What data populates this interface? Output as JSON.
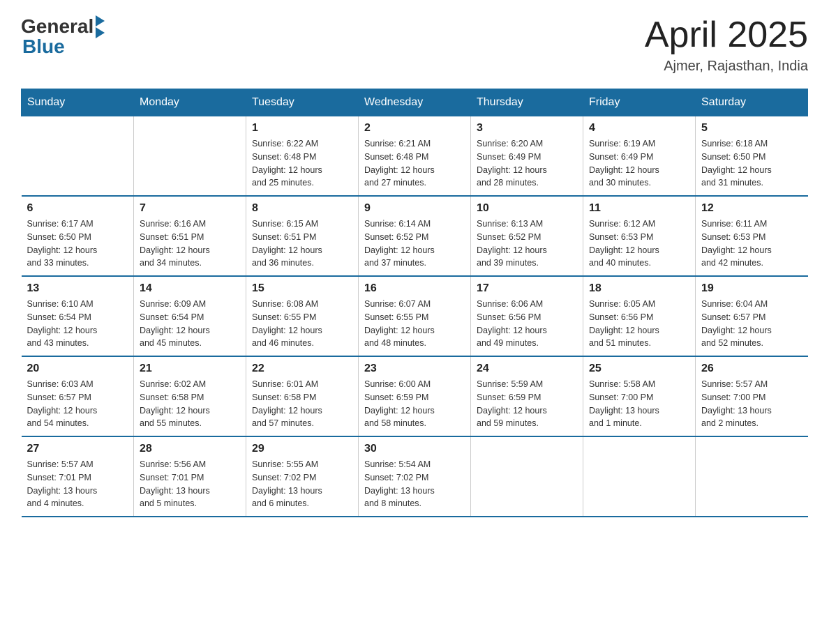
{
  "header": {
    "logo_general": "General",
    "logo_blue": "Blue",
    "title": "April 2025",
    "location": "Ajmer, Rajasthan, India"
  },
  "days_of_week": [
    "Sunday",
    "Monday",
    "Tuesday",
    "Wednesday",
    "Thursday",
    "Friday",
    "Saturday"
  ],
  "weeks": [
    [
      {
        "day": "",
        "info": ""
      },
      {
        "day": "",
        "info": ""
      },
      {
        "day": "1",
        "info": "Sunrise: 6:22 AM\nSunset: 6:48 PM\nDaylight: 12 hours\nand 25 minutes."
      },
      {
        "day": "2",
        "info": "Sunrise: 6:21 AM\nSunset: 6:48 PM\nDaylight: 12 hours\nand 27 minutes."
      },
      {
        "day": "3",
        "info": "Sunrise: 6:20 AM\nSunset: 6:49 PM\nDaylight: 12 hours\nand 28 minutes."
      },
      {
        "day": "4",
        "info": "Sunrise: 6:19 AM\nSunset: 6:49 PM\nDaylight: 12 hours\nand 30 minutes."
      },
      {
        "day": "5",
        "info": "Sunrise: 6:18 AM\nSunset: 6:50 PM\nDaylight: 12 hours\nand 31 minutes."
      }
    ],
    [
      {
        "day": "6",
        "info": "Sunrise: 6:17 AM\nSunset: 6:50 PM\nDaylight: 12 hours\nand 33 minutes."
      },
      {
        "day": "7",
        "info": "Sunrise: 6:16 AM\nSunset: 6:51 PM\nDaylight: 12 hours\nand 34 minutes."
      },
      {
        "day": "8",
        "info": "Sunrise: 6:15 AM\nSunset: 6:51 PM\nDaylight: 12 hours\nand 36 minutes."
      },
      {
        "day": "9",
        "info": "Sunrise: 6:14 AM\nSunset: 6:52 PM\nDaylight: 12 hours\nand 37 minutes."
      },
      {
        "day": "10",
        "info": "Sunrise: 6:13 AM\nSunset: 6:52 PM\nDaylight: 12 hours\nand 39 minutes."
      },
      {
        "day": "11",
        "info": "Sunrise: 6:12 AM\nSunset: 6:53 PM\nDaylight: 12 hours\nand 40 minutes."
      },
      {
        "day": "12",
        "info": "Sunrise: 6:11 AM\nSunset: 6:53 PM\nDaylight: 12 hours\nand 42 minutes."
      }
    ],
    [
      {
        "day": "13",
        "info": "Sunrise: 6:10 AM\nSunset: 6:54 PM\nDaylight: 12 hours\nand 43 minutes."
      },
      {
        "day": "14",
        "info": "Sunrise: 6:09 AM\nSunset: 6:54 PM\nDaylight: 12 hours\nand 45 minutes."
      },
      {
        "day": "15",
        "info": "Sunrise: 6:08 AM\nSunset: 6:55 PM\nDaylight: 12 hours\nand 46 minutes."
      },
      {
        "day": "16",
        "info": "Sunrise: 6:07 AM\nSunset: 6:55 PM\nDaylight: 12 hours\nand 48 minutes."
      },
      {
        "day": "17",
        "info": "Sunrise: 6:06 AM\nSunset: 6:56 PM\nDaylight: 12 hours\nand 49 minutes."
      },
      {
        "day": "18",
        "info": "Sunrise: 6:05 AM\nSunset: 6:56 PM\nDaylight: 12 hours\nand 51 minutes."
      },
      {
        "day": "19",
        "info": "Sunrise: 6:04 AM\nSunset: 6:57 PM\nDaylight: 12 hours\nand 52 minutes."
      }
    ],
    [
      {
        "day": "20",
        "info": "Sunrise: 6:03 AM\nSunset: 6:57 PM\nDaylight: 12 hours\nand 54 minutes."
      },
      {
        "day": "21",
        "info": "Sunrise: 6:02 AM\nSunset: 6:58 PM\nDaylight: 12 hours\nand 55 minutes."
      },
      {
        "day": "22",
        "info": "Sunrise: 6:01 AM\nSunset: 6:58 PM\nDaylight: 12 hours\nand 57 minutes."
      },
      {
        "day": "23",
        "info": "Sunrise: 6:00 AM\nSunset: 6:59 PM\nDaylight: 12 hours\nand 58 minutes."
      },
      {
        "day": "24",
        "info": "Sunrise: 5:59 AM\nSunset: 6:59 PM\nDaylight: 12 hours\nand 59 minutes."
      },
      {
        "day": "25",
        "info": "Sunrise: 5:58 AM\nSunset: 7:00 PM\nDaylight: 13 hours\nand 1 minute."
      },
      {
        "day": "26",
        "info": "Sunrise: 5:57 AM\nSunset: 7:00 PM\nDaylight: 13 hours\nand 2 minutes."
      }
    ],
    [
      {
        "day": "27",
        "info": "Sunrise: 5:57 AM\nSunset: 7:01 PM\nDaylight: 13 hours\nand 4 minutes."
      },
      {
        "day": "28",
        "info": "Sunrise: 5:56 AM\nSunset: 7:01 PM\nDaylight: 13 hours\nand 5 minutes."
      },
      {
        "day": "29",
        "info": "Sunrise: 5:55 AM\nSunset: 7:02 PM\nDaylight: 13 hours\nand 6 minutes."
      },
      {
        "day": "30",
        "info": "Sunrise: 5:54 AM\nSunset: 7:02 PM\nDaylight: 13 hours\nand 8 minutes."
      },
      {
        "day": "",
        "info": ""
      },
      {
        "day": "",
        "info": ""
      },
      {
        "day": "",
        "info": ""
      }
    ]
  ]
}
